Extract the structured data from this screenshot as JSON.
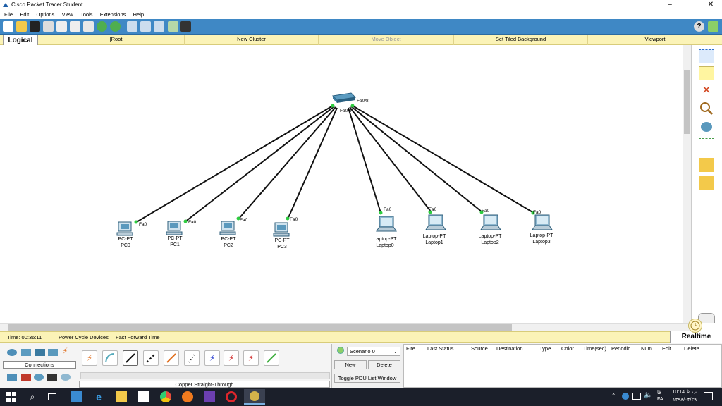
{
  "window": {
    "title": "Cisco Packet Tracer Student",
    "minimize": "–",
    "restore": "❐",
    "close": "✕"
  },
  "menu": [
    "File",
    "Edit",
    "Options",
    "View",
    "Tools",
    "Extensions",
    "Help"
  ],
  "topbar": {
    "logical_tab": "Logical",
    "root": "[Root]",
    "new_cluster": "New Cluster",
    "move_object": "Move Object",
    "set_tiled_background": "Set Tiled Background",
    "viewport": "Viewport",
    "help_icon": "?"
  },
  "topology": {
    "switch": {
      "ports": [
        "Fa0/8",
        "Fa0/4"
      ]
    },
    "devices": [
      {
        "type": "PC-PT",
        "name": "PC0",
        "port": "Fa0"
      },
      {
        "type": "PC-PT",
        "name": "PC1",
        "port": "Fa0"
      },
      {
        "type": "PC-PT",
        "name": "PC2",
        "port": "Fa0"
      },
      {
        "type": "PC-PT",
        "name": "PC3",
        "port": "Fa0"
      },
      {
        "type": "Laptop-PT",
        "name": "Laptop0",
        "port": "Fa0"
      },
      {
        "type": "Laptop-PT",
        "name": "Laptop1",
        "port": "Fa0"
      },
      {
        "type": "Laptop-PT",
        "name": "Laptop2",
        "port": "Fa0"
      },
      {
        "type": "Laptop-PT",
        "name": "Laptop3",
        "port": "Fa0"
      }
    ]
  },
  "status": {
    "time": "Time: 00:36:11",
    "power_cycle": "Power Cycle Devices",
    "fast_forward": "Fast Forward Time",
    "realtime": "Realtime"
  },
  "bottom": {
    "category_label": "Connections",
    "connection_label": "Copper Straight-Through",
    "scenario": "Scenario 0",
    "new_btn": "New",
    "delete_btn": "Delete",
    "toggle_btn": "Toggle PDU List Window",
    "pdu_headers": [
      "Fire",
      "Last Status",
      "Source",
      "Destination",
      "Type",
      "Color",
      "Time(sec)",
      "Periodic",
      "Num",
      "Edit",
      "Delete"
    ]
  },
  "taskbar": {
    "time": "10:14 ب.ظ",
    "date": "۱۳۹۸/۰۴/۲۹",
    "lang": "FA",
    "lang2": "فا"
  },
  "colors": {
    "toolbar": "#3f88c5",
    "yellow_bar": "#fbf3b7",
    "link_up": "#2ecc40",
    "taskbar": "#1b1f2a"
  }
}
